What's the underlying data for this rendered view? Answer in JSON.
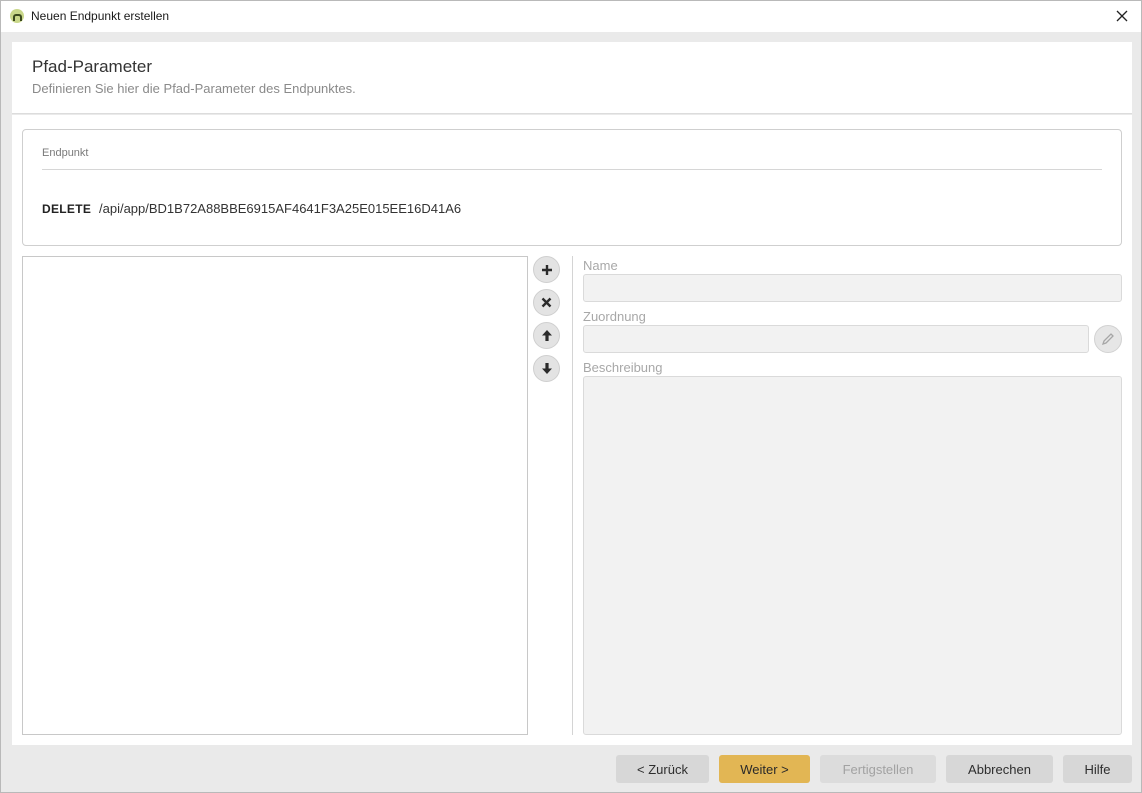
{
  "window": {
    "title": "Neuen Endpunkt erstellen"
  },
  "header": {
    "title": "Pfad-Parameter",
    "subtitle": "Definieren Sie hier die Pfad-Parameter des Endpunktes."
  },
  "endpoint": {
    "legend": "Endpunkt",
    "method": "DELETE",
    "path": "/api/app/BD1B72A88BBE6915AF4641F3A25E015EE16D41A6"
  },
  "params": {
    "items": []
  },
  "form": {
    "name_label": "Name",
    "name_value": "",
    "zuordnung_label": "Zuordnung",
    "zuordnung_value": "",
    "beschreibung_label": "Beschreibung",
    "beschreibung_value": ""
  },
  "footer": {
    "back_label": "< Zurück",
    "next_label": "Weiter >",
    "finish_label": "Fertigstellen",
    "cancel_label": "Abbrechen",
    "help_label": "Hilfe"
  },
  "colors": {
    "accent": "#e2b654",
    "panel": "#ffffff",
    "background": "#eaeaea"
  }
}
